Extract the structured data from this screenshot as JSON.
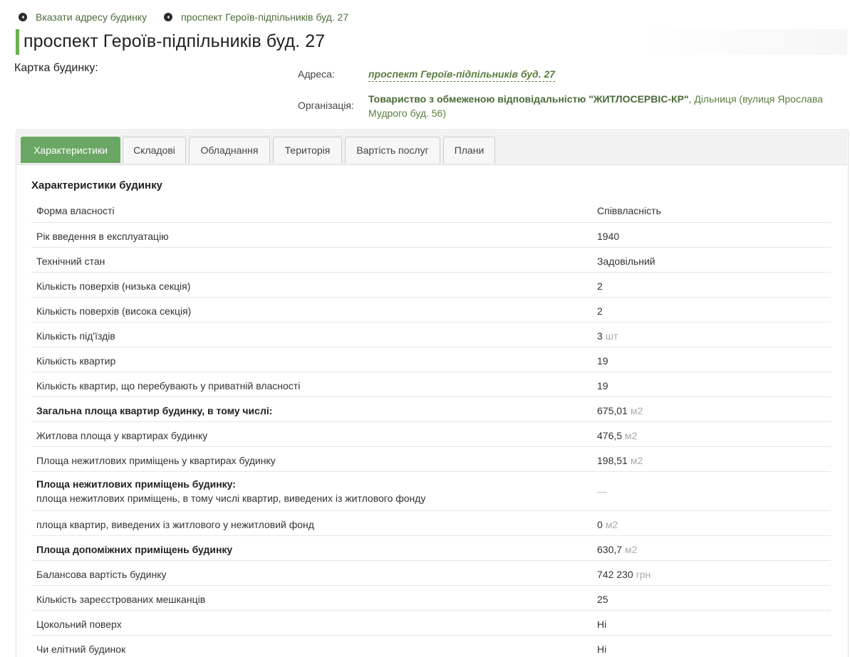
{
  "breadcrumb": [
    {
      "label": "Вказати адресу будинку",
      "icon": "chevron-left-circle-icon"
    },
    {
      "label": "проспект Героїв-підпільників буд. 27",
      "icon": "chevron-left-circle-icon"
    }
  ],
  "page_title": "проспект Героїв-підпільників буд. 27",
  "card_label": "Картка будинку:",
  "address": {
    "label": "Адреса:",
    "value": "проспект Героїв-підпільників буд. 27"
  },
  "organization": {
    "label": "Організація:",
    "name": "Товариство з обмеженою відповідальністю \"ЖИТЛОСЕРВІС-КР\"",
    "rest": ", Дільниця (вулиця Ярослава Мудрого буд. 56)"
  },
  "tabs": [
    {
      "label": "Характеристики",
      "active": true
    },
    {
      "label": "Складові",
      "active": false
    },
    {
      "label": "Обладнання",
      "active": false
    },
    {
      "label": "Територія",
      "active": false
    },
    {
      "label": "Вартість послуг",
      "active": false
    },
    {
      "label": "Плани",
      "active": false
    }
  ],
  "section_title": "Характеристики будинку",
  "rows": [
    {
      "label": "Форма власності",
      "value": "Співвласність",
      "unit": ""
    },
    {
      "label": "Рік введення в експлуатацію",
      "value": "1940",
      "unit": ""
    },
    {
      "label": "Технічний стан",
      "value": "Задовільний",
      "unit": ""
    },
    {
      "label": "Кількість поверхів (низька секція)",
      "value": "2",
      "unit": ""
    },
    {
      "label": "Кількість поверхів (висока секція)",
      "value": "2",
      "unit": ""
    },
    {
      "label": "Кількість під'їздів",
      "value": "3",
      "unit": "шт"
    },
    {
      "label": "Кількість квартир",
      "value": "19",
      "unit": ""
    },
    {
      "label": "Кількість квартир, що перебувають у приватній власності",
      "value": "19",
      "unit": ""
    },
    {
      "label": "Загальна площа квартир будинку, в тому числі:",
      "value": "675,01",
      "unit": "м2",
      "bold": true
    },
    {
      "label": "Житлова площа у квартирах будинку",
      "value": "476,5",
      "unit": "м2"
    },
    {
      "label": "Площа нежитлових приміщень у квартирах будинку",
      "value": "198,51",
      "unit": "м2"
    },
    {
      "label": "Площа нежитлових приміщень будинку:",
      "sub": "площа нежитлових приміщень, в тому числі квартир, виведених із житлового фонду",
      "value": "—",
      "unit": "",
      "bold": true,
      "tall": true
    },
    {
      "label": "площа квартир, виведених із житлового у нежитловий фонд",
      "value": "0",
      "unit": "м2"
    },
    {
      "label": "Площа допоміжних приміщень будинку",
      "value": "630,7",
      "unit": "м2",
      "bold": true
    },
    {
      "label": "Балансова вартість будинку",
      "value": "742 230",
      "unit": "грн"
    },
    {
      "label": "Кількість зареєстрованих мешканців",
      "value": "25",
      "unit": ""
    },
    {
      "label": "Цокольний поверх",
      "value": "Ні",
      "unit": ""
    },
    {
      "label": "Чи елітний будинок",
      "value": "Ні",
      "unit": ""
    }
  ],
  "colors": {
    "accent": "#6aa764",
    "link": "#5a7e3e",
    "title_bar": "#6cb14f"
  }
}
